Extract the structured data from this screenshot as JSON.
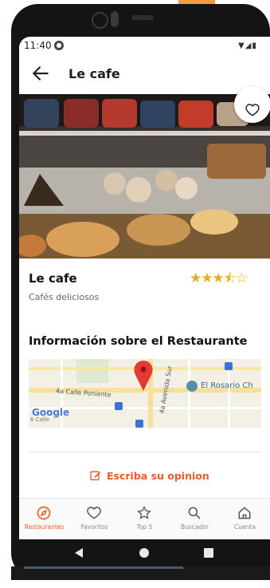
{
  "status": {
    "time": "11:40"
  },
  "appbar": {
    "title": "Le cafe"
  },
  "restaurant": {
    "name": "Le cafe",
    "description": "Cafés deliciosos",
    "rating": 3.5,
    "rating_max": 5
  },
  "info": {
    "heading": "Información sobre el Restaurante",
    "map": {
      "street_1": "4a Calle Poniente",
      "street_2": "4a Avenida Sur",
      "place": "El Rosario Ch",
      "logo": "Google",
      "corner": "6 Calle"
    }
  },
  "review": {
    "label": "Escriba su opinion"
  },
  "nav": {
    "items": [
      {
        "label": "Restaurantes",
        "icon": "compass-icon",
        "active": true
      },
      {
        "label": "Favoritos",
        "icon": "heart-icon",
        "active": false
      },
      {
        "label": "Top 5",
        "icon": "star-icon",
        "active": false
      },
      {
        "label": "Buscador",
        "icon": "search-icon",
        "active": false
      },
      {
        "label": "Cuenta",
        "icon": "home-icon",
        "active": false
      }
    ]
  },
  "colors": {
    "accent": "#e85d28",
    "star": "#e0b020",
    "frame": "#141414"
  }
}
